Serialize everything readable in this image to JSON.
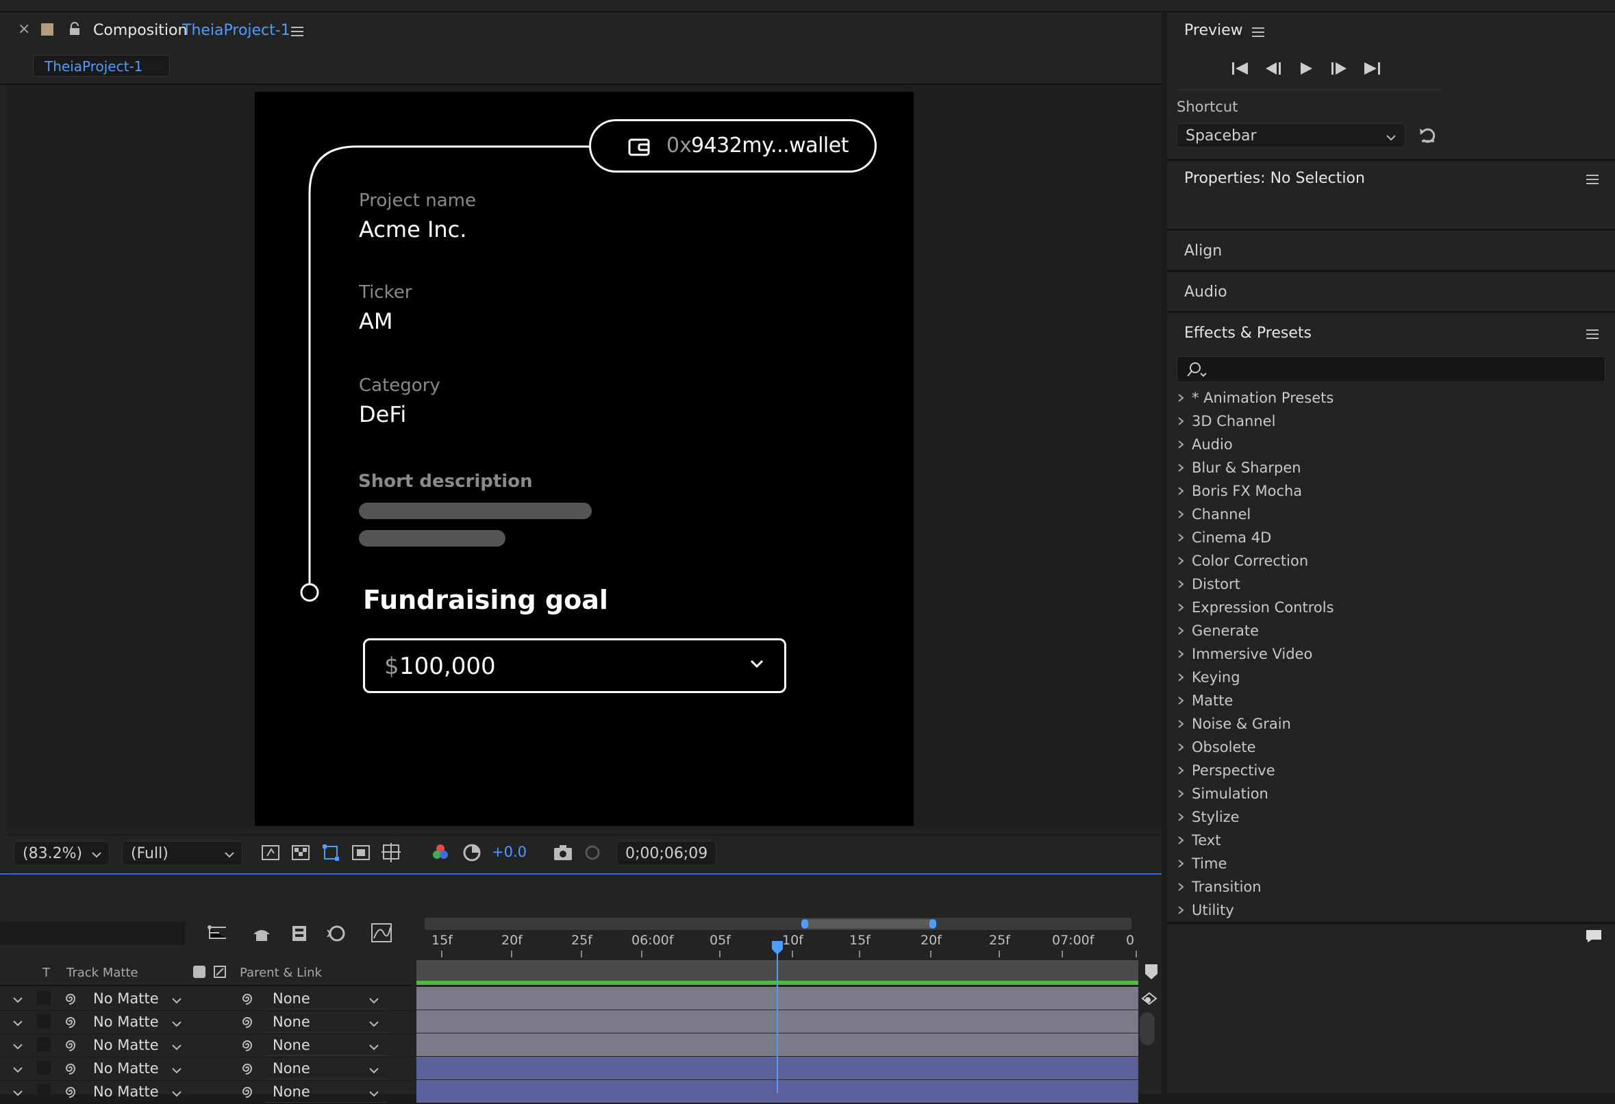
{
  "composition": {
    "close_glyph": "×",
    "panel_label": "Composition",
    "name": "TheiaProject-1",
    "tab_label": "TheiaProject-1"
  },
  "canvas": {
    "wallet_prefix": "0x",
    "wallet_rest": "9432my...wallet",
    "fields": [
      {
        "label": "Project name",
        "value": "Acme Inc."
      },
      {
        "label": "Ticker",
        "value": "AM"
      },
      {
        "label": "Category",
        "value": "DeFi"
      }
    ],
    "short_description_label": "Short description",
    "fundraising_label": "Fundraising goal",
    "amount_currency": "$",
    "amount_value": "100,000"
  },
  "viewer_toolbar": {
    "zoom": "(83.2%)",
    "resolution": "(Full)",
    "exposure": "+0.0",
    "timecode": "0;00;06;09"
  },
  "preview": {
    "title": "Preview",
    "shortcut_label": "Shortcut",
    "shortcut_value": "Spacebar"
  },
  "properties": {
    "title": "Properties: No Selection"
  },
  "align": {
    "title": "Align"
  },
  "audio": {
    "title": "Audio"
  },
  "effects": {
    "title": "Effects & Presets",
    "items": [
      "* Animation Presets",
      "3D Channel",
      "Audio",
      "Blur & Sharpen",
      "Boris FX Mocha",
      "Channel",
      "Cinema 4D",
      "Color Correction",
      "Distort",
      "Expression Controls",
      "Generate",
      "Immersive Video",
      "Keying",
      "Matte",
      "Noise & Grain",
      "Obsolete",
      "Perspective",
      "Simulation",
      "Stylize",
      "Text",
      "Time",
      "Transition",
      "Utility"
    ]
  },
  "timeline": {
    "col_t": "T",
    "col_track_matte": "Track Matte",
    "col_parent": "Parent & Link",
    "ruler": [
      "15f",
      "20f",
      "25f",
      "06:00f",
      "05f",
      "10f",
      "15f",
      "20f",
      "25f",
      "07:00f",
      "0"
    ],
    "rows": [
      {
        "matte": "No Matte",
        "parent": "None"
      },
      {
        "matte": "No Matte",
        "parent": "None"
      },
      {
        "matte": "No Matte",
        "parent": "None"
      },
      {
        "matte": "No Matte",
        "parent": "None"
      },
      {
        "matte": "No Matte",
        "parent": "None"
      }
    ],
    "bar_colors": [
      "#7a7a88",
      "#7a7a88",
      "#7a7a88",
      "#5b5f9a",
      "#5b5f9a"
    ],
    "accent": "#2d6fd1"
  }
}
